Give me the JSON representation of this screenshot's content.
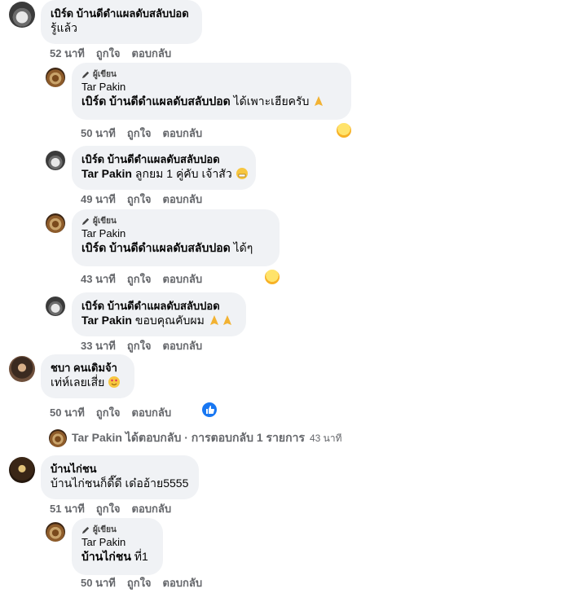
{
  "author_badge": "ผู้เขียน",
  "action_like": "ถูกใจ",
  "action_reply": "ตอบกลับ",
  "comments": [
    {
      "name": "เบิร์ด บ้านดีดำแผลดับสลับปอด",
      "text": "รู้แล้ว",
      "time": "52 นาที"
    },
    {
      "name": "Tar Pakin",
      "mention": "เบิร์ด บ้านดีดำแผลดับสลับปอด",
      "text": " ได้เพาะเฮียครับ",
      "time": "50 นาที"
    },
    {
      "name": "เบิร์ด บ้านดีดำแผลดับสลับปอด",
      "mention": "Tar Pakin",
      "text": " ลูกยม 1 คู่คับ เจ้าสัว",
      "time": "49 นาที"
    },
    {
      "name": "Tar Pakin",
      "mention": "เบิร์ด บ้านดีดำแผลดับสลับปอด",
      "text": " ได้ๆ",
      "time": "43 นาที"
    },
    {
      "name": "เบิร์ด บ้านดีดำแผลดับสลับปอด",
      "mention": "Tar Pakin",
      "text": " ขอบคุณคับผม",
      "time": "33 นาที"
    },
    {
      "name": "ชบา คนเดิมจ้า",
      "text": "เท่ห์เลยเสี่ย",
      "time": "50 นาที"
    },
    {
      "name": "บ้านไก่ชน",
      "text": "บ้านไก่ชนก็ดี๊ดี เด๋ออ้าย5555",
      "time": "51 นาที"
    },
    {
      "name": "Tar Pakin",
      "mention": "บ้านไก่ชน",
      "text": " ที่1",
      "time": "50 นาที"
    }
  ],
  "reply_summary": {
    "name": "Tar Pakin",
    "text": " ได้ตอบกลับ · การตอบกลับ 1 รายการ",
    "time": "43 นาที"
  }
}
